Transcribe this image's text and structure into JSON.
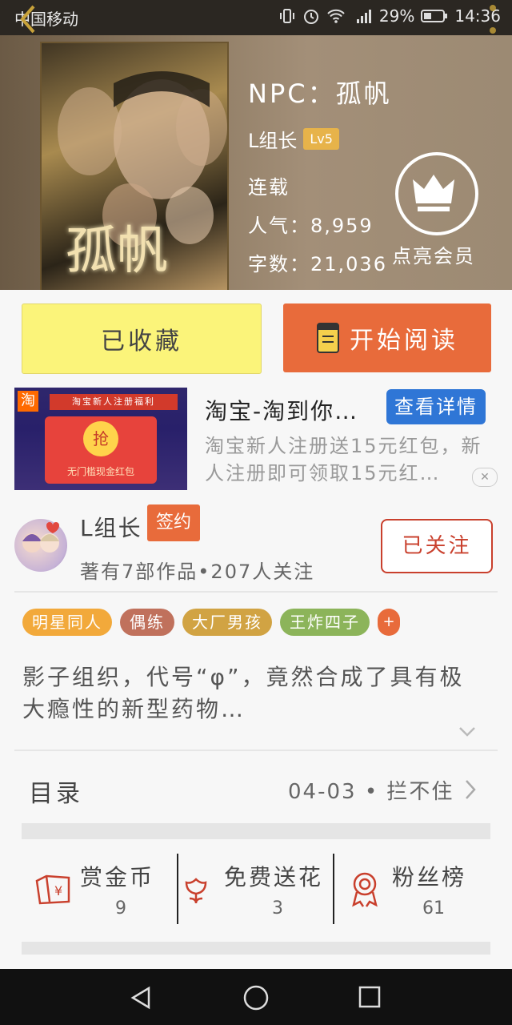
{
  "status_bar": {
    "carrier": "中国移动",
    "battery": "29%",
    "time": "14:36"
  },
  "book": {
    "cover_title": "孤帆",
    "title": "NPC：孤帆",
    "author": "L组长",
    "author_level": "Lv5",
    "status": "连载",
    "popularity": "人气：8,959",
    "word_count": "字数：21,036",
    "vip_label": "点亮会员"
  },
  "actions": {
    "collected_label": "已收藏",
    "read_label": "开始阅读"
  },
  "ad": {
    "banner_strip": "淘宝新人注册福利",
    "taobao_mark": "淘",
    "grab_label": "抢",
    "envelope_caption": "无门槛现金红包",
    "title": "淘宝-淘到你…",
    "button_label": "查看详情",
    "description": "淘宝新人注册送15元红包，新人注册即可领取15元红…",
    "close_label": "✕"
  },
  "author_section": {
    "name": "L组长",
    "signed_label": "签约",
    "stats": "著有7部作品•207人关注",
    "follow_label": "已关注"
  },
  "tags": [
    {
      "label": "明星同人",
      "color": "#f2a93b"
    },
    {
      "label": "偶练",
      "color": "#c0715c"
    },
    {
      "label": "大厂男孩",
      "color": "#d1a343"
    },
    {
      "label": "王炸四子",
      "color": "#8cb45a"
    }
  ],
  "tags_more": "+",
  "intro": "影子组织，代号“φ”，竟然合成了具有极大瘾性的新型药物…",
  "catalog": {
    "label": "目录",
    "latest": "04-03 • 拦不住"
  },
  "rewards": [
    {
      "label": "赏金币",
      "value": "9",
      "icon": "red-envelope-icon"
    },
    {
      "label": "免费送花",
      "value": "3",
      "icon": "flower-icon"
    },
    {
      "label": "粉丝榜",
      "value": "61",
      "icon": "medal-icon"
    }
  ],
  "colors": {
    "accent": "#e86b3b",
    "collected_bg": "#fbf47a",
    "ad_button": "#2f76d6",
    "follow_red": "#c9402d"
  }
}
